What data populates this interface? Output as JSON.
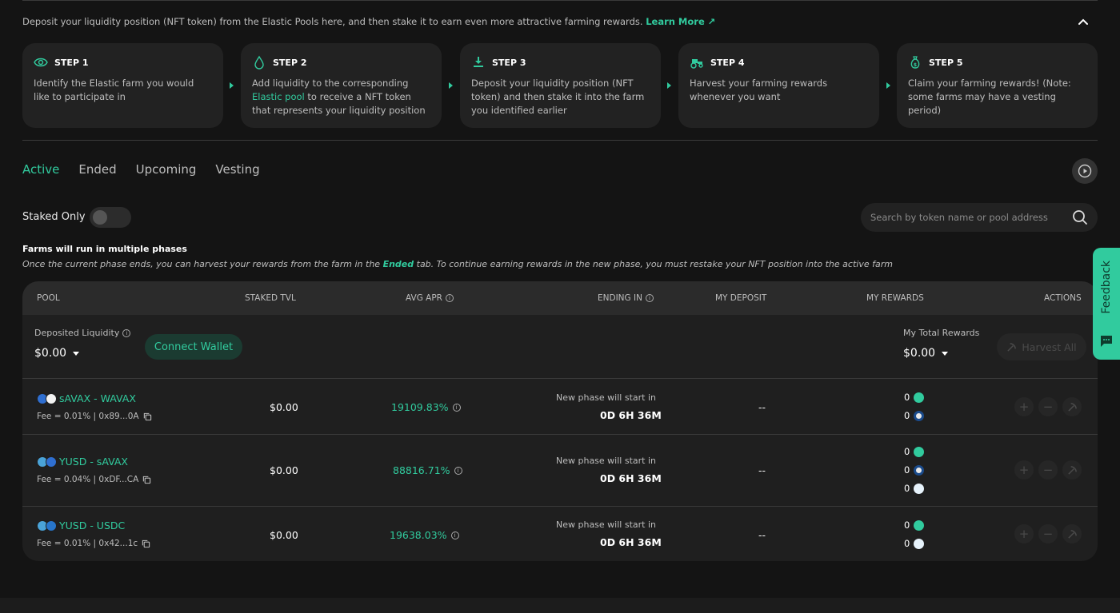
{
  "intro": {
    "text": "Deposit your liquidity position (NFT token) from the Elastic Pools here, and then stake it to earn even more attractive farming rewards.",
    "learn_more": "Learn More ↗"
  },
  "steps": [
    {
      "title": "STEP 1",
      "icon": "eye-icon",
      "body": "Identify the Elastic farm you would like to participate in"
    },
    {
      "title": "STEP 2",
      "icon": "droplet-icon",
      "body_before": "Add liquidity to the corresponding",
      "body_link": "Elastic pool",
      "body_after": "to receive a NFT token that represents your liquidity position"
    },
    {
      "title": "STEP 3",
      "icon": "download-icon",
      "body": "Deposit your liquidity position (NFT token) and then stake it into the farm you identified earlier"
    },
    {
      "title": "STEP 4",
      "icon": "tractor-icon",
      "body": "Harvest your farming rewards whenever you want"
    },
    {
      "title": "STEP 5",
      "icon": "money-bag-icon",
      "body": "Claim your farming rewards! (Note: some farms may have a vesting period)"
    }
  ],
  "tabs": [
    "Active",
    "Ended",
    "Upcoming",
    "Vesting"
  ],
  "staked_only": "Staked Only",
  "search": {
    "placeholder": "Search by token name or pool address"
  },
  "phase": {
    "title": "Farms will run in multiple phases",
    "note_before": "Once the current phase ends, you can harvest your rewards from the farm in the",
    "note_link": "Ended",
    "note_after": "tab. To continue earning rewards in the new phase, you must restake your NFT position into the active farm"
  },
  "table": {
    "headers": {
      "pool": "POOL",
      "tvl": "STAKED TVL",
      "apr": "AVG APR",
      "ending": "ENDING IN",
      "deposit": "MY DEPOSIT",
      "rewards": "MY REWARDS",
      "actions": "ACTIONS"
    },
    "summary": {
      "deposited_label": "Deposited Liquidity",
      "deposited_value": "$0.00",
      "connect": "Connect Wallet",
      "rewards_label": "My Total Rewards",
      "rewards_value": "$0.00",
      "harvest_all": "Harvest All"
    },
    "rows": [
      {
        "pair": "sAVAX - WAVAX",
        "fee": "Fee = 0.01% | 0x89...0A",
        "tvl": "$0.00",
        "apr": "19109.83%",
        "ending_label": "New phase will start in",
        "ending_time": "0D 6H 36M",
        "deposit": "--",
        "rewards": [
          "0",
          "0"
        ]
      },
      {
        "pair": "YUSD - sAVAX",
        "fee": "Fee = 0.04% | 0xDF...CA",
        "tvl": "$0.00",
        "apr": "88816.71%",
        "ending_label": "New phase will start in",
        "ending_time": "0D 6H 36M",
        "deposit": "--",
        "rewards": [
          "0",
          "0",
          "0"
        ]
      },
      {
        "pair": "YUSD - USDC",
        "fee": "Fee = 0.01% | 0x42...1c",
        "tvl": "$0.00",
        "apr": "19638.03%",
        "ending_label": "New phase will start in",
        "ending_time": "0D 6H 36M",
        "deposit": "--",
        "rewards": [
          "0",
          "0"
        ]
      }
    ]
  },
  "feedback": "Feedback",
  "colors": {
    "accent": "#31cb9e",
    "background": "#141414",
    "card": "#222222"
  }
}
